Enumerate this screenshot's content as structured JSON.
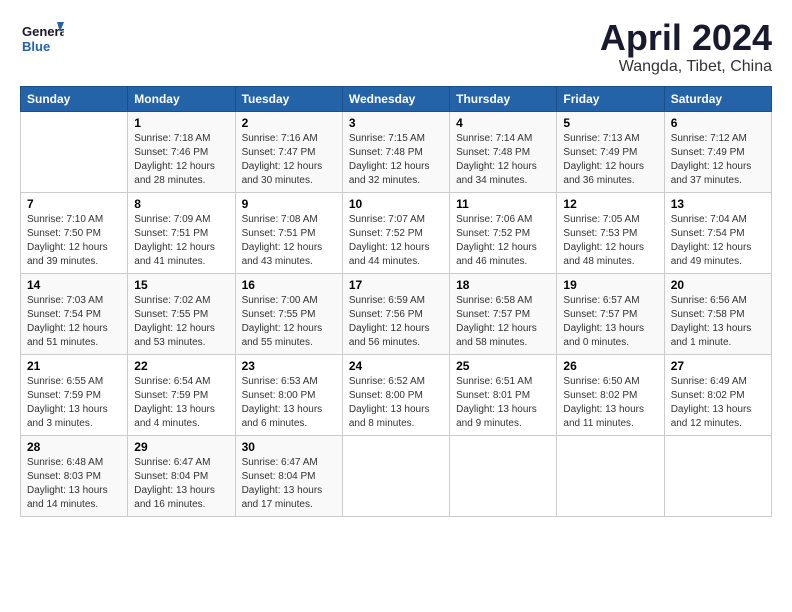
{
  "logo": {
    "line1": "General",
    "line2": "Blue"
  },
  "title": "April 2024",
  "subtitle": "Wangda, Tibet, China",
  "header": {
    "days": [
      "Sunday",
      "Monday",
      "Tuesday",
      "Wednesday",
      "Thursday",
      "Friday",
      "Saturday"
    ]
  },
  "weeks": [
    [
      {
        "num": "",
        "detail": ""
      },
      {
        "num": "1",
        "detail": "Sunrise: 7:18 AM\nSunset: 7:46 PM\nDaylight: 12 hours\nand 28 minutes."
      },
      {
        "num": "2",
        "detail": "Sunrise: 7:16 AM\nSunset: 7:47 PM\nDaylight: 12 hours\nand 30 minutes."
      },
      {
        "num": "3",
        "detail": "Sunrise: 7:15 AM\nSunset: 7:48 PM\nDaylight: 12 hours\nand 32 minutes."
      },
      {
        "num": "4",
        "detail": "Sunrise: 7:14 AM\nSunset: 7:48 PM\nDaylight: 12 hours\nand 34 minutes."
      },
      {
        "num": "5",
        "detail": "Sunrise: 7:13 AM\nSunset: 7:49 PM\nDaylight: 12 hours\nand 36 minutes."
      },
      {
        "num": "6",
        "detail": "Sunrise: 7:12 AM\nSunset: 7:49 PM\nDaylight: 12 hours\nand 37 minutes."
      }
    ],
    [
      {
        "num": "7",
        "detail": "Sunrise: 7:10 AM\nSunset: 7:50 PM\nDaylight: 12 hours\nand 39 minutes."
      },
      {
        "num": "8",
        "detail": "Sunrise: 7:09 AM\nSunset: 7:51 PM\nDaylight: 12 hours\nand 41 minutes."
      },
      {
        "num": "9",
        "detail": "Sunrise: 7:08 AM\nSunset: 7:51 PM\nDaylight: 12 hours\nand 43 minutes."
      },
      {
        "num": "10",
        "detail": "Sunrise: 7:07 AM\nSunset: 7:52 PM\nDaylight: 12 hours\nand 44 minutes."
      },
      {
        "num": "11",
        "detail": "Sunrise: 7:06 AM\nSunset: 7:52 PM\nDaylight: 12 hours\nand 46 minutes."
      },
      {
        "num": "12",
        "detail": "Sunrise: 7:05 AM\nSunset: 7:53 PM\nDaylight: 12 hours\nand 48 minutes."
      },
      {
        "num": "13",
        "detail": "Sunrise: 7:04 AM\nSunset: 7:54 PM\nDaylight: 12 hours\nand 49 minutes."
      }
    ],
    [
      {
        "num": "14",
        "detail": "Sunrise: 7:03 AM\nSunset: 7:54 PM\nDaylight: 12 hours\nand 51 minutes."
      },
      {
        "num": "15",
        "detail": "Sunrise: 7:02 AM\nSunset: 7:55 PM\nDaylight: 12 hours\nand 53 minutes."
      },
      {
        "num": "16",
        "detail": "Sunrise: 7:00 AM\nSunset: 7:55 PM\nDaylight: 12 hours\nand 55 minutes."
      },
      {
        "num": "17",
        "detail": "Sunrise: 6:59 AM\nSunset: 7:56 PM\nDaylight: 12 hours\nand 56 minutes."
      },
      {
        "num": "18",
        "detail": "Sunrise: 6:58 AM\nSunset: 7:57 PM\nDaylight: 12 hours\nand 58 minutes."
      },
      {
        "num": "19",
        "detail": "Sunrise: 6:57 AM\nSunset: 7:57 PM\nDaylight: 13 hours\nand 0 minutes."
      },
      {
        "num": "20",
        "detail": "Sunrise: 6:56 AM\nSunset: 7:58 PM\nDaylight: 13 hours\nand 1 minute."
      }
    ],
    [
      {
        "num": "21",
        "detail": "Sunrise: 6:55 AM\nSunset: 7:59 PM\nDaylight: 13 hours\nand 3 minutes."
      },
      {
        "num": "22",
        "detail": "Sunrise: 6:54 AM\nSunset: 7:59 PM\nDaylight: 13 hours\nand 4 minutes."
      },
      {
        "num": "23",
        "detail": "Sunrise: 6:53 AM\nSunset: 8:00 PM\nDaylight: 13 hours\nand 6 minutes."
      },
      {
        "num": "24",
        "detail": "Sunrise: 6:52 AM\nSunset: 8:00 PM\nDaylight: 13 hours\nand 8 minutes."
      },
      {
        "num": "25",
        "detail": "Sunrise: 6:51 AM\nSunset: 8:01 PM\nDaylight: 13 hours\nand 9 minutes."
      },
      {
        "num": "26",
        "detail": "Sunrise: 6:50 AM\nSunset: 8:02 PM\nDaylight: 13 hours\nand 11 minutes."
      },
      {
        "num": "27",
        "detail": "Sunrise: 6:49 AM\nSunset: 8:02 PM\nDaylight: 13 hours\nand 12 minutes."
      }
    ],
    [
      {
        "num": "28",
        "detail": "Sunrise: 6:48 AM\nSunset: 8:03 PM\nDaylight: 13 hours\nand 14 minutes."
      },
      {
        "num": "29",
        "detail": "Sunrise: 6:47 AM\nSunset: 8:04 PM\nDaylight: 13 hours\nand 16 minutes."
      },
      {
        "num": "30",
        "detail": "Sunrise: 6:47 AM\nSunset: 8:04 PM\nDaylight: 13 hours\nand 17 minutes."
      },
      {
        "num": "",
        "detail": ""
      },
      {
        "num": "",
        "detail": ""
      },
      {
        "num": "",
        "detail": ""
      },
      {
        "num": "",
        "detail": ""
      }
    ]
  ]
}
